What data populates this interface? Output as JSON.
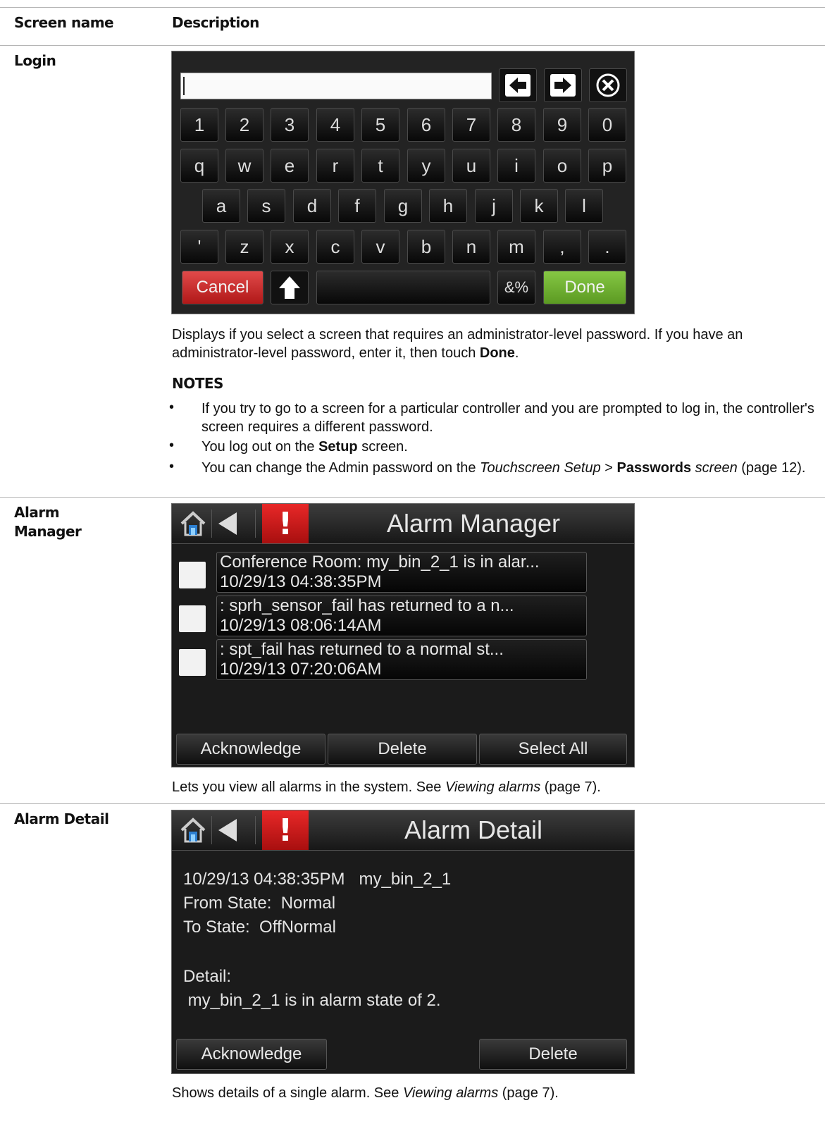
{
  "header": {
    "col_screen": "Screen name",
    "col_desc": "Description"
  },
  "login": {
    "label": "Login",
    "keys_row1": [
      "1",
      "2",
      "3",
      "4",
      "5",
      "6",
      "7",
      "8",
      "9",
      "0"
    ],
    "keys_row2": [
      "q",
      "w",
      "e",
      "r",
      "t",
      "y",
      "u",
      "i",
      "o",
      "p"
    ],
    "keys_row3": [
      "a",
      "s",
      "d",
      "f",
      "g",
      "h",
      "j",
      "k",
      "l"
    ],
    "keys_row4": [
      "'",
      "z",
      "x",
      "c",
      "v",
      "b",
      "n",
      "m",
      ",",
      "."
    ],
    "cancel": "Cancel",
    "sym": "&%",
    "done": "Done",
    "desc1": "Displays if you select a screen that requires an administrator-level password. If you have an administrator-level password, enter it, then touch ",
    "desc1_bold": "Done",
    "desc1_end": ".",
    "notes_heading": "NOTES",
    "note1": "If you try to go to a screen for a particular controller and you are prompted to log in, the controller's screen requires a different password.",
    "note2_pre": "You log out on the ",
    "note2_bold": "Setup",
    "note2_post": " screen.",
    "note3_pre": "You can change the Admin password on the ",
    "note3_italic": "Touchscreen Setup",
    "note3_mid": " > ",
    "note3_bold": "Passwords",
    "note3_italic2": " screen",
    "note3_post": " (page 12)."
  },
  "alarm_manager": {
    "label": "Alarm Manager",
    "title": "Alarm Manager",
    "alarms": [
      {
        "line1": "Conference Room: my_bin_2_1 is in alar...",
        "line2": "10/29/13 04:38:35PM"
      },
      {
        "line1": ": sprh_sensor_fail has returned to a n...",
        "line2": "10/29/13 08:06:14AM"
      },
      {
        "line1": ": spt_fail has returned to a normal st...",
        "line2": "10/29/13 07:20:06AM"
      }
    ],
    "btn_ack": "Acknowledge",
    "btn_delete": "Delete",
    "btn_select_all": "Select All",
    "desc_pre": "Lets you view all alarms in the system. See ",
    "desc_italic": "Viewing alarms",
    "desc_post": " (page 7)."
  },
  "alarm_detail": {
    "label": "Alarm Detail",
    "title": "Alarm Detail",
    "line1": "10/29/13 04:38:35PM   my_bin_2_1",
    "line2": "From State:  Normal",
    "line3": "To State:  OffNormal",
    "line4": "Detail:",
    "line5": " my_bin_2_1 is in alarm state of 2.",
    "btn_ack": "Acknowledge",
    "btn_delete": "Delete",
    "desc_pre": "Shows details of a single alarm. See ",
    "desc_italic": "Viewing alarms",
    "desc_post": " (page 7)."
  }
}
